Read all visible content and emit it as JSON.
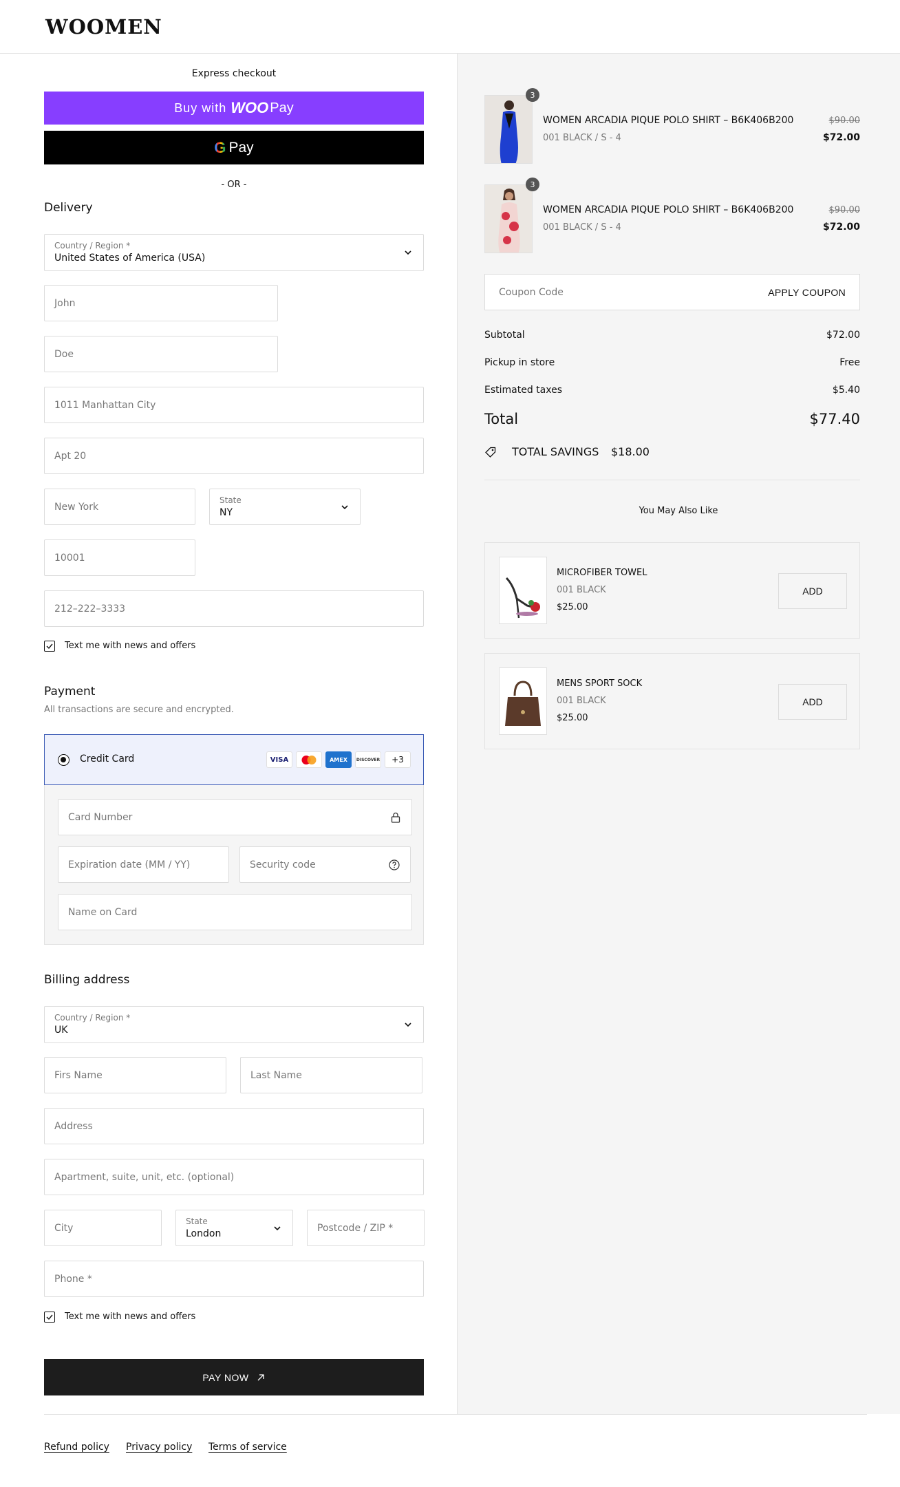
{
  "brand": "WOOMEN",
  "express": {
    "title": "Express checkout",
    "woopay_prefix": "Buy with",
    "woopay_brand": "WOO",
    "woopay_suffix": "Pay",
    "gpay_g": "G",
    "gpay_label": "Pay",
    "or": "- OR -"
  },
  "delivery": {
    "title": "Delivery",
    "country_label": "Country / Region *",
    "country_value": "United States of America (USA)",
    "first_name": "John",
    "last_name": "Doe",
    "address": "1011 Manhattan City",
    "apartment": "Apt 20",
    "city": "New York",
    "state_label": "State",
    "state_value": "NY",
    "zip": "10001",
    "phone": "212–222–3333",
    "newsletter": "Text me with news and offers"
  },
  "payment": {
    "title": "Payment",
    "subtitle": "All transactions are secure and encrypted.",
    "method": "Credit Card",
    "card_logos": [
      "VISA",
      "MC",
      "AMEX",
      "DISCOVER"
    ],
    "more_cards": "+3",
    "card_number": "Card Number",
    "expiration": "Expiration date (MM / YY)",
    "security": "Security code",
    "name_on_card": "Name on Card"
  },
  "billing": {
    "title": "Billing address",
    "country_label": "Country / Region *",
    "country_value": "UK",
    "first_name": "Firs Name",
    "last_name": "Last Name",
    "address": "Address",
    "apartment": "Apartment, suite, unit, etc. (optional)",
    "city": "City",
    "state_label": "State",
    "state_value": "London",
    "postcode": "Postcode / ZIP *",
    "phone": "Phone *",
    "newsletter": "Text me with news and offers"
  },
  "pay_now": "PAY NOW",
  "footer": {
    "links": [
      "Refund policy",
      "Privacy policy",
      "Terms of service"
    ]
  },
  "cart": {
    "items": [
      {
        "qty": "3",
        "name": "WOMEN ARCADIA PIQUE POLO SHIRT – B6K406B200",
        "variant": "001 BLACK / S - 4",
        "old_price": "$90.00",
        "price": "$72.00"
      },
      {
        "qty": "3",
        "name": "WOMEN ARCADIA PIQUE POLO SHIRT – B6K406B200",
        "variant": "001 BLACK / S - 4",
        "old_price": "$90.00",
        "price": "$72.00"
      }
    ],
    "coupon_placeholder": "Coupon Code",
    "apply_coupon": "APPLY COUPON",
    "subtotal_label": "Subtotal",
    "subtotal": "$72.00",
    "pickup_label": "Pickup in store",
    "pickup": "Free",
    "taxes_label": "Estimated taxes",
    "taxes": "$5.40",
    "total_label": "Total",
    "total": "$77.40",
    "savings_label": "TOTAL SAVINGS",
    "savings": "$18.00"
  },
  "recommendations": {
    "title": "You May Also Like",
    "items": [
      {
        "name": "MICROFIBER TOWEL",
        "variant": "001 BLACK",
        "price": "$25.00",
        "button": "ADD"
      },
      {
        "name": "MENS SPORT SOCK",
        "variant": "001 BLACK",
        "price": "$25.00",
        "button": "ADD"
      }
    ]
  },
  "colors": {
    "woopay": "#873eff",
    "accent_border": "#3b5bb5",
    "selected_bg": "#eef1fc",
    "pay_now_bg": "#1d1d1d"
  }
}
